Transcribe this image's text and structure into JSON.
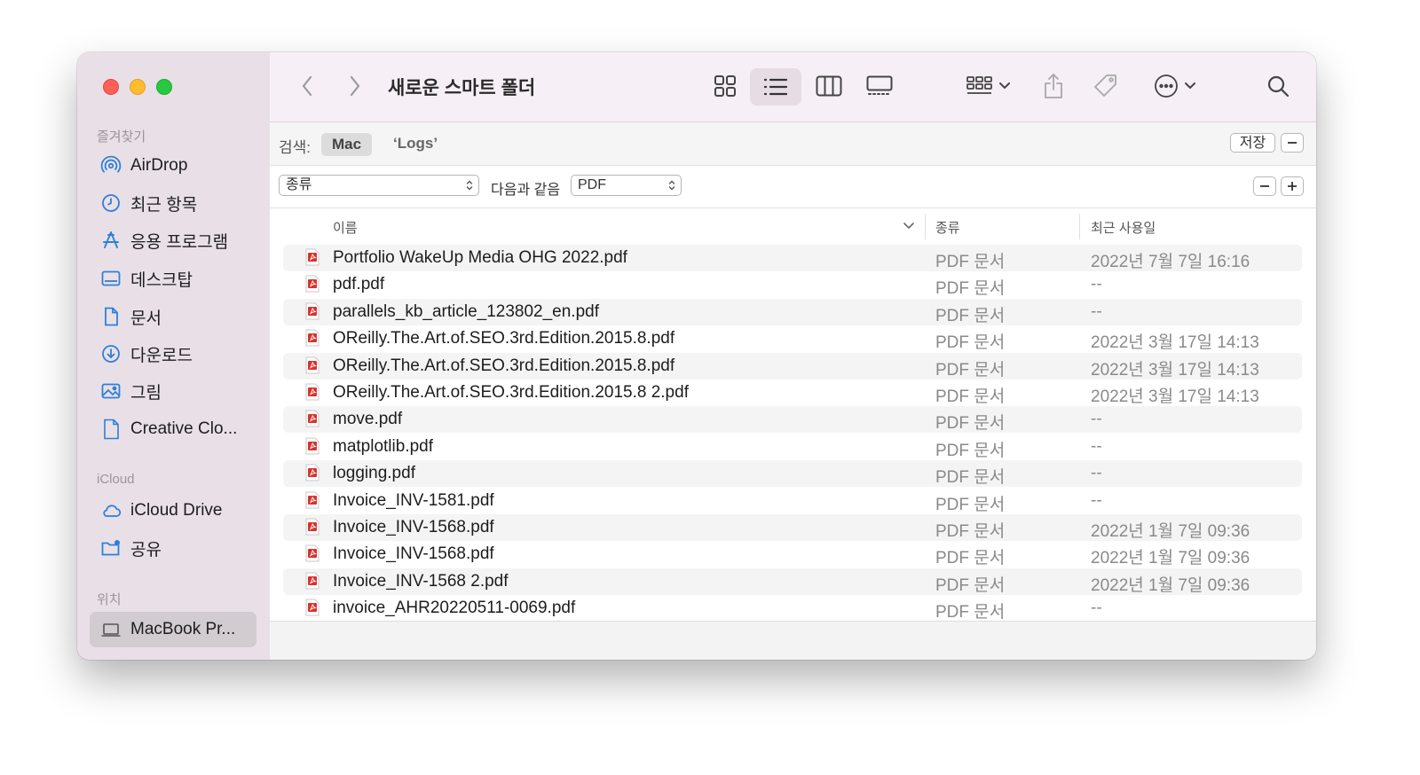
{
  "window": {
    "title": "새로운 스마트 폴더"
  },
  "sidebar": {
    "favorites_header": "즐겨찾기",
    "favorites": [
      {
        "label": "AirDrop",
        "icon": "airdrop-icon"
      },
      {
        "label": "최근 항목",
        "icon": "clock-icon"
      },
      {
        "label": "응용 프로그램",
        "icon": "applications-icon"
      },
      {
        "label": "데스크탑",
        "icon": "desktop-icon"
      },
      {
        "label": "문서",
        "icon": "document-icon"
      },
      {
        "label": "다운로드",
        "icon": "download-icon"
      },
      {
        "label": "그림",
        "icon": "pictures-icon"
      },
      {
        "label": "Creative Clo...",
        "icon": "file-icon"
      }
    ],
    "icloud_header": "iCloud",
    "icloud": [
      {
        "label": "iCloud Drive",
        "icon": "cloud-icon"
      },
      {
        "label": "공유",
        "icon": "shared-folder-icon"
      }
    ],
    "locations_header": "위치",
    "locations": [
      {
        "label": "MacBook Pr...",
        "icon": "laptop-icon",
        "selected": true
      }
    ]
  },
  "search": {
    "label": "검색:",
    "scope_mac": "Mac",
    "scope_logs": "‘Logs’",
    "save_label": "저장"
  },
  "criteria": {
    "attribute": "종류",
    "operator": "다음과 같음",
    "value": "PDF"
  },
  "table": {
    "columns": {
      "name": "이름",
      "kind": "종류",
      "date": "최근 사용일"
    },
    "rows": [
      {
        "name": "Portfolio WakeUp Media OHG 2022.pdf",
        "kind": "PDF 문서",
        "date": "2022년 7월 7일 16:16"
      },
      {
        "name": "pdf.pdf",
        "kind": "PDF 문서",
        "date": "--"
      },
      {
        "name": "parallels_kb_article_123802_en.pdf",
        "kind": "PDF 문서",
        "date": "--"
      },
      {
        "name": "OReilly.The.Art.of.SEO.3rd.Edition.2015.8.pdf",
        "kind": "PDF 문서",
        "date": "2022년 3월 17일 14:13"
      },
      {
        "name": "OReilly.The.Art.of.SEO.3rd.Edition.2015.8.pdf",
        "kind": "PDF 문서",
        "date": "2022년 3월 17일 14:13"
      },
      {
        "name": "OReilly.The.Art.of.SEO.3rd.Edition.2015.8 2.pdf",
        "kind": "PDF 문서",
        "date": "2022년 3월 17일 14:13"
      },
      {
        "name": "move.pdf",
        "kind": "PDF 문서",
        "date": "--"
      },
      {
        "name": "matplotlib.pdf",
        "kind": "PDF 문서",
        "date": "--"
      },
      {
        "name": "logging.pdf",
        "kind": "PDF 문서",
        "date": "--"
      },
      {
        "name": "Invoice_INV-1581.pdf",
        "kind": "PDF 문서",
        "date": "--"
      },
      {
        "name": "Invoice_INV-1568.pdf",
        "kind": "PDF 문서",
        "date": "2022년 1월 7일 09:36"
      },
      {
        "name": "Invoice_INV-1568.pdf",
        "kind": "PDF 문서",
        "date": "2022년 1월 7일 09:36"
      },
      {
        "name": "Invoice_INV-1568 2.pdf",
        "kind": "PDF 문서",
        "date": "2022년 1월 7일 09:36"
      },
      {
        "name": "invoice_AHR20220511-0069.pdf",
        "kind": "PDF 문서",
        "date": "--"
      }
    ]
  },
  "colors": {
    "accent": "#2e7fd9",
    "sidebar_bg": "#e9e0e7",
    "pdf_red": "#d9322c"
  }
}
